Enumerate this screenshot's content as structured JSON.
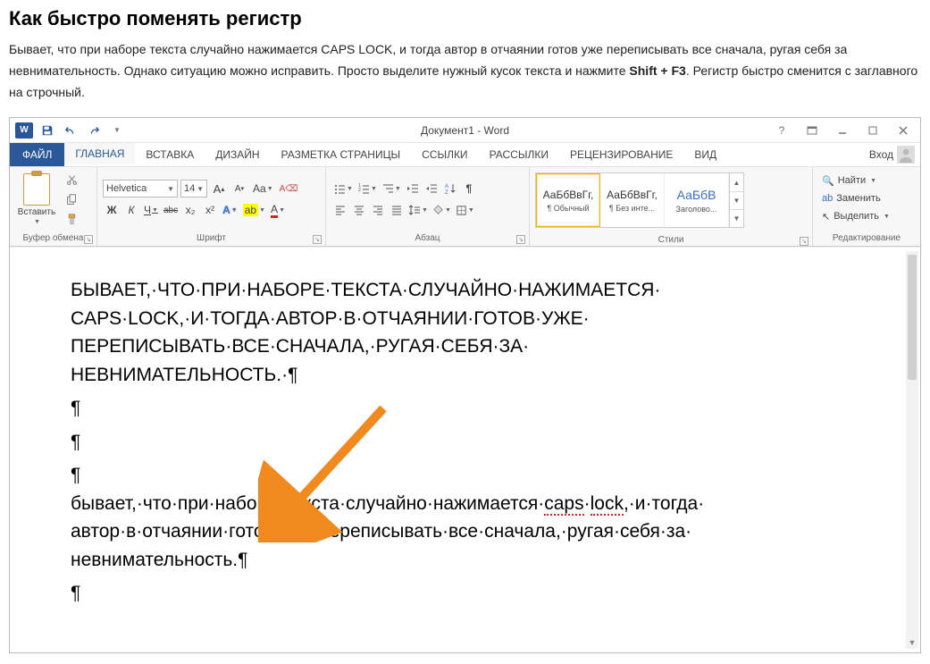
{
  "article": {
    "heading": "Как быстро поменять регистр",
    "para1_a": "Бывает, что при наборе текста случайно нажимается CAPS LOCK, и тогда автор в отчаянии готов уже переписывать все сначала, ругая себя за невнимательность. Однако ситуацию можно исправить. Просто выделите нужный кусок текста и нажмите ",
    "para1_bold": "Shift + F3",
    "para1_b": ". Регистр быстро сменится с заглавного на строчный."
  },
  "titlebar": {
    "title": "Документ1 - Word",
    "help": "?"
  },
  "tabs": {
    "file": "ФАЙЛ",
    "home": "ГЛАВНАЯ",
    "insert": "ВСТАВКА",
    "design": "ДИЗАЙН",
    "layout": "РАЗМЕТКА СТРАНИЦЫ",
    "references": "ССЫЛКИ",
    "mailings": "РАССЫЛКИ",
    "review": "РЕЦЕНЗИРОВАНИЕ",
    "view": "ВИД",
    "signin": "Вход"
  },
  "ribbon": {
    "clipboard": {
      "paste": "Вставить",
      "group_label": "Буфер обмена"
    },
    "font": {
      "name": "Helvetica",
      "size": "14",
      "grow": "A",
      "shrink": "A",
      "case": "Aa",
      "clear": "✖",
      "bold": "Ж",
      "italic": "К",
      "underline": "Ч",
      "strike": "abc",
      "sub": "x₂",
      "sup": "x²",
      "texteffect": "A",
      "highlight": "✎",
      "color": "A",
      "group_label": "Шрифт"
    },
    "paragraph": {
      "group_label": "Абзац"
    },
    "styles": {
      "s1_preview": "АаБбВвГг,",
      "s1_name": "¶ Обычный",
      "s2_preview": "АаБбВвГг,",
      "s2_name": "¶ Без инте...",
      "s3_preview": "АаБбВ",
      "s3_name": "Заголово...",
      "group_label": "Стили"
    },
    "editing": {
      "find": "Найти",
      "replace": "Заменить",
      "select": "Выделить",
      "group_label": "Редактирование"
    }
  },
  "document": {
    "upper1": "БЫВАЕТ,·ЧТО·ПРИ·НАБОРЕ·ТЕКСТА·СЛУЧАЙНО·НАЖИМАЕТСЯ·",
    "upper2": "CAPS·LOCK,·И·ТОГДА·АВТОР·В·ОТЧАЯНИИ·ГОТОВ·УЖЕ·",
    "upper3": "ПЕРЕПИСЫВАТЬ·ВСЕ·СНАЧАЛА,·РУГАЯ·СЕБЯ·ЗА·",
    "upper4": "НЕВНИМАТЕЛЬНОСТЬ.·¶",
    "p": "¶",
    "lower1a": "бывает,·что·при·наборе·текста·случайно·нажимается·",
    "lower1_s1": "caps",
    "lower1_mid": "·",
    "lower1_s2": "lock",
    "lower1b": ",·и·тогда·",
    "lower2": "автор·в·отчаянии·готов·уже·переписывать·все·сначала,·ругая·себя·за·",
    "lower3": "невнимательность.¶"
  }
}
